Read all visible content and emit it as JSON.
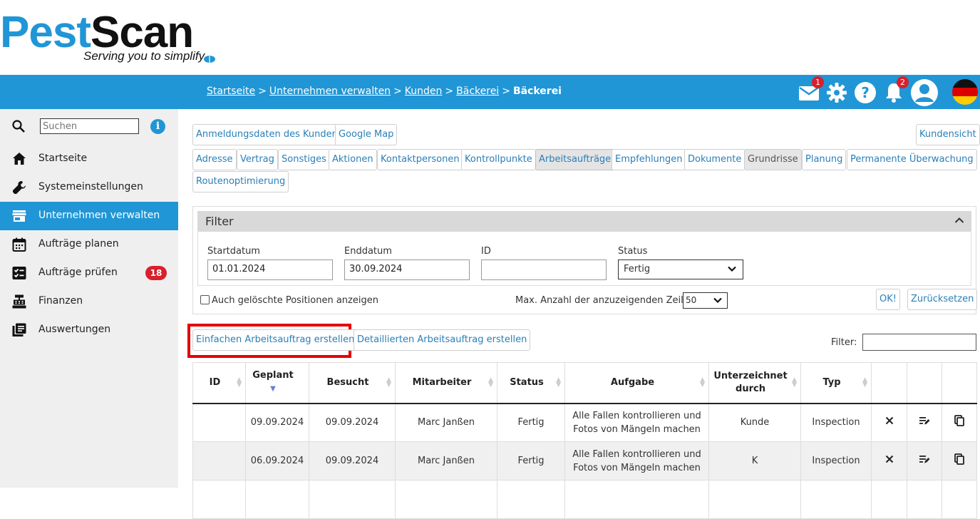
{
  "brand": {
    "name_part1": "Pest",
    "name_part2": "Scan",
    "tagline": "Serving you to simplify",
    "color": "#2196d6"
  },
  "breadcrumb": {
    "items": [
      "Startseite",
      "Unternehmen verwalten",
      "Kunden",
      "Bäckerei"
    ],
    "separator": ">",
    "current": "Bäckerei"
  },
  "top_icons": {
    "mail": {
      "icon": "mail-icon",
      "badge": "1"
    },
    "settings": {
      "icon": "gear-icon"
    },
    "help": {
      "icon": "help-icon"
    },
    "notifications": {
      "icon": "bell-icon",
      "badge": "2"
    },
    "user": {
      "icon": "user-icon"
    },
    "language": {
      "icon": "german-flag-icon"
    }
  },
  "sidebar": {
    "search_placeholder": "Suchen",
    "info_label": "i",
    "items": [
      {
        "label": "Startseite",
        "icon": "home-icon"
      },
      {
        "label": "Systemeinstellungen",
        "icon": "wrench-icon"
      },
      {
        "label": "Unternehmen verwalten",
        "icon": "store-icon",
        "active": true
      },
      {
        "label": "Aufträge planen",
        "icon": "calendar-icon"
      },
      {
        "label": "Aufträge prüfen",
        "icon": "checklist-icon",
        "badge": "18"
      },
      {
        "label": "Finanzen",
        "icon": "cash-register-icon"
      },
      {
        "label": "Auswertungen",
        "icon": "reports-icon"
      }
    ]
  },
  "tabs": {
    "row1": [
      "Anmeldungsdaten des Kunden",
      "Google Map"
    ],
    "customer_view": "Kundensicht",
    "row2": [
      "Adresse",
      "Vertrag",
      "Sonstiges",
      "Aktionen",
      "Kontaktpersonen",
      "Kontrollpunkte",
      "Arbeitsaufträge",
      "Empfehlungen",
      "Dokumente",
      "Grundrisse",
      "Planung",
      "Permanente Überwachung"
    ],
    "row3": [
      "Routenoptimierung"
    ],
    "active": "Arbeitsaufträge"
  },
  "filter": {
    "title": "Filter",
    "start_label": "Startdatum",
    "start_value": "01.01.2024",
    "end_label": "Enddatum",
    "end_value": "30.09.2024",
    "id_label": "ID",
    "id_value": "",
    "status_label": "Status",
    "status_value": "Fertig",
    "show_deleted_label": "Auch gelöschte Positionen anzeigen",
    "max_rows_label": "Max. Anzahl der anzuzeigenden Zeilen",
    "max_rows_value": "50",
    "ok_label": "OK!",
    "reset_label": "Zurücksetzen"
  },
  "actions": {
    "simple_order": "Einfachen Arbeitsauftrag erstellen",
    "detailed_order": "Detaillierten Arbeitsauftrag erstellen",
    "table_filter_label": "Filter:"
  },
  "table": {
    "columns": [
      "ID",
      "Geplant",
      "Besucht",
      "Mitarbeiter",
      "Status",
      "Aufgabe",
      "Unterzeichnet durch",
      "Typ",
      "",
      "",
      ""
    ],
    "rows": [
      {
        "id": "",
        "planned": "09.09.2024",
        "visited": "09.09.2024",
        "employee": "Marc Janßen",
        "status": "Fertig",
        "task": "Alle Fallen kontrollieren und Fotos von Mängeln machen",
        "signed_by": "Kunde",
        "type": "Inspection"
      },
      {
        "id": "",
        "planned": "06.09.2024",
        "visited": "09.09.2024",
        "employee": "Marc Janßen",
        "status": "Fertig",
        "task": "Alle Fallen kontrollieren und Fotos von Mängeln machen",
        "signed_by": "K",
        "type": "Inspection"
      },
      {
        "id": "",
        "planned": "",
        "visited": "",
        "employee": "",
        "status": "",
        "task": "",
        "signed_by": "",
        "type": ""
      }
    ]
  }
}
